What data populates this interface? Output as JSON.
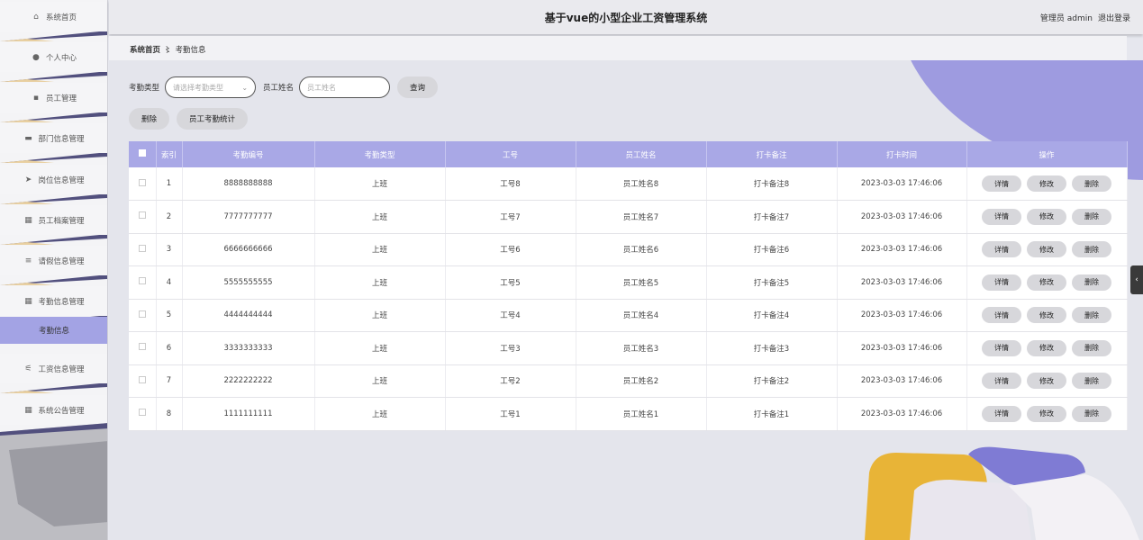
{
  "header": {
    "title": "基于vue的小型企业工资管理系统",
    "user": "管理员 admin",
    "logout": "退出登录"
  },
  "sidebar": {
    "items": [
      {
        "label": "系统首页",
        "icon": "home-icon",
        "glyph": "⌂"
      },
      {
        "label": "个人中心",
        "icon": "user-icon",
        "glyph": "●"
      },
      {
        "label": "员工管理",
        "icon": "chat-icon",
        "glyph": "▪"
      },
      {
        "label": "部门信息管理",
        "icon": "folder-icon",
        "glyph": "▬"
      },
      {
        "label": "岗位信息管理",
        "icon": "send-icon",
        "glyph": "➤"
      },
      {
        "label": "员工档案管理",
        "icon": "grid-icon",
        "glyph": "▦"
      },
      {
        "label": "请假信息管理",
        "icon": "menu-icon",
        "glyph": "≡"
      },
      {
        "label": "考勤信息管理",
        "icon": "grid-icon",
        "glyph": "▦"
      },
      {
        "label": "工资信息管理",
        "icon": "sliders-icon",
        "glyph": "⚟"
      },
      {
        "label": "系统公告管理",
        "icon": "grid-icon",
        "glyph": "▦"
      }
    ],
    "active_sub": "考勤信息"
  },
  "breadcrumb": {
    "home": "系统首页",
    "sep": "〻",
    "current": "考勤信息"
  },
  "search": {
    "type_label": "考勤类型",
    "type_placeholder": "请选择考勤类型",
    "name_label": "员工姓名",
    "name_placeholder": "员工姓名",
    "query_button": "查询"
  },
  "actions": {
    "delete": "删除",
    "stats": "员工考勤统计"
  },
  "table": {
    "headers": [
      "索引",
      "考勤编号",
      "考勤类型",
      "工号",
      "员工姓名",
      "打卡备注",
      "打卡时间",
      "操作"
    ],
    "rows": [
      {
        "idx": "1",
        "code": "8888888888",
        "type": "上班",
        "no": "工号8",
        "name": "员工姓名8",
        "note": "打卡备注8",
        "time": "2023-03-03 17:46:06"
      },
      {
        "idx": "2",
        "code": "7777777777",
        "type": "上班",
        "no": "工号7",
        "name": "员工姓名7",
        "note": "打卡备注7",
        "time": "2023-03-03 17:46:06"
      },
      {
        "idx": "3",
        "code": "6666666666",
        "type": "上班",
        "no": "工号6",
        "name": "员工姓名6",
        "note": "打卡备注6",
        "time": "2023-03-03 17:46:06"
      },
      {
        "idx": "4",
        "code": "5555555555",
        "type": "上班",
        "no": "工号5",
        "name": "员工姓名5",
        "note": "打卡备注5",
        "time": "2023-03-03 17:46:06"
      },
      {
        "idx": "5",
        "code": "4444444444",
        "type": "上班",
        "no": "工号4",
        "name": "员工姓名4",
        "note": "打卡备注4",
        "time": "2023-03-03 17:46:06"
      },
      {
        "idx": "6",
        "code": "3333333333",
        "type": "上班",
        "no": "工号3",
        "name": "员工姓名3",
        "note": "打卡备注3",
        "time": "2023-03-03 17:46:06"
      },
      {
        "idx": "7",
        "code": "2222222222",
        "type": "上班",
        "no": "工号2",
        "name": "员工姓名2",
        "note": "打卡备注2",
        "time": "2023-03-03 17:46:06"
      },
      {
        "idx": "8",
        "code": "1111111111",
        "type": "上班",
        "no": "工号1",
        "name": "员工姓名1",
        "note": "打卡备注1",
        "time": "2023-03-03 17:46:06"
      }
    ],
    "row_actions": {
      "detail": "详情",
      "edit": "修改",
      "delete": "删除"
    }
  },
  "colors": {
    "accent": "#a9a8e6",
    "active": "#a3a3e4",
    "button": "#d7d7db"
  }
}
